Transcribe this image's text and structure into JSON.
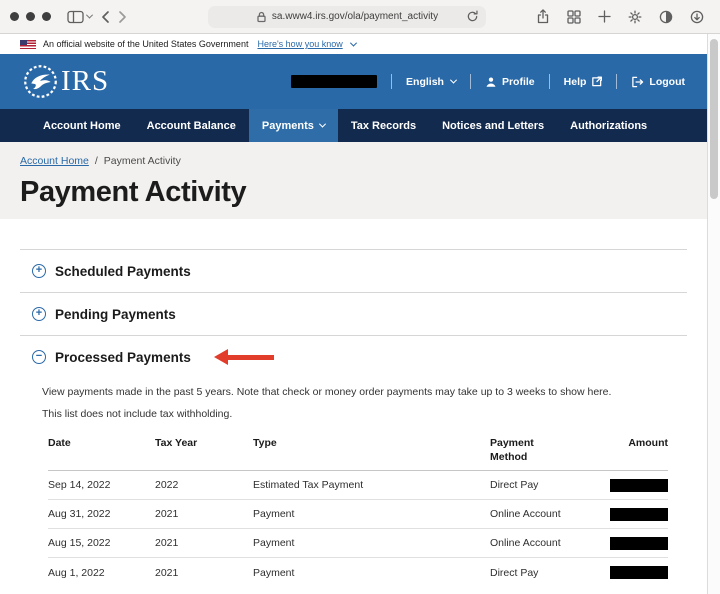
{
  "browser": {
    "url": "sa.www4.irs.gov/ola/payment_activity"
  },
  "gov_banner": {
    "text": "An official website of the United States Government",
    "link": "Here's how you know"
  },
  "header": {
    "site_name": "IRS",
    "username_redacted": true,
    "language_label": "English",
    "profile_label": "Profile",
    "help_label": "Help",
    "logout_label": "Logout"
  },
  "nav": {
    "items": [
      {
        "label": "Account Home",
        "active": false
      },
      {
        "label": "Account Balance",
        "active": false
      },
      {
        "label": "Payments",
        "active": true
      },
      {
        "label": "Tax Records",
        "active": false
      },
      {
        "label": "Notices and Letters",
        "active": false
      },
      {
        "label": "Authorizations",
        "active": false
      }
    ]
  },
  "breadcrumb": {
    "parent": "Account Home",
    "separator": "/",
    "current": "Payment Activity"
  },
  "page": {
    "title": "Payment Activity"
  },
  "accordions": [
    {
      "label": "Scheduled Payments",
      "expanded": false
    },
    {
      "label": "Pending Payments",
      "expanded": false
    },
    {
      "label": "Processed Payments",
      "expanded": true,
      "annotated_with_red_arrow": true
    }
  ],
  "processed": {
    "description": "View payments made in the past 5 years. Note that check or money order payments may take up to 3 weeks to show here.",
    "note": "This list does not include tax withholding.",
    "table": {
      "headers": [
        "Date",
        "Tax Year",
        "Type",
        "Payment Method",
        "Amount"
      ],
      "rows": [
        {
          "date": "Sep 14, 2022",
          "tax_year": "2022",
          "type": "Estimated Tax Payment",
          "method": "Direct Pay",
          "amount_redacted": true
        },
        {
          "date": "Aug 31, 2022",
          "tax_year": "2021",
          "type": "Payment",
          "method": "Online Account",
          "amount_redacted": true
        },
        {
          "date": "Aug 15, 2022",
          "tax_year": "2021",
          "type": "Payment",
          "method": "Online Account",
          "amount_redacted": true
        },
        {
          "date": "Aug 1, 2022",
          "tax_year": "2021",
          "type": "Payment",
          "method": "Direct Pay",
          "amount_redacted": true
        }
      ]
    }
  },
  "colors": {
    "header_blue": "#2a69a8",
    "nav_navy": "#122a4e",
    "active_tab_blue": "#2e6da8",
    "link_blue": "#2a69a8",
    "annotation_arrow_red": "#e23c2b",
    "redaction_black": "#000000"
  }
}
